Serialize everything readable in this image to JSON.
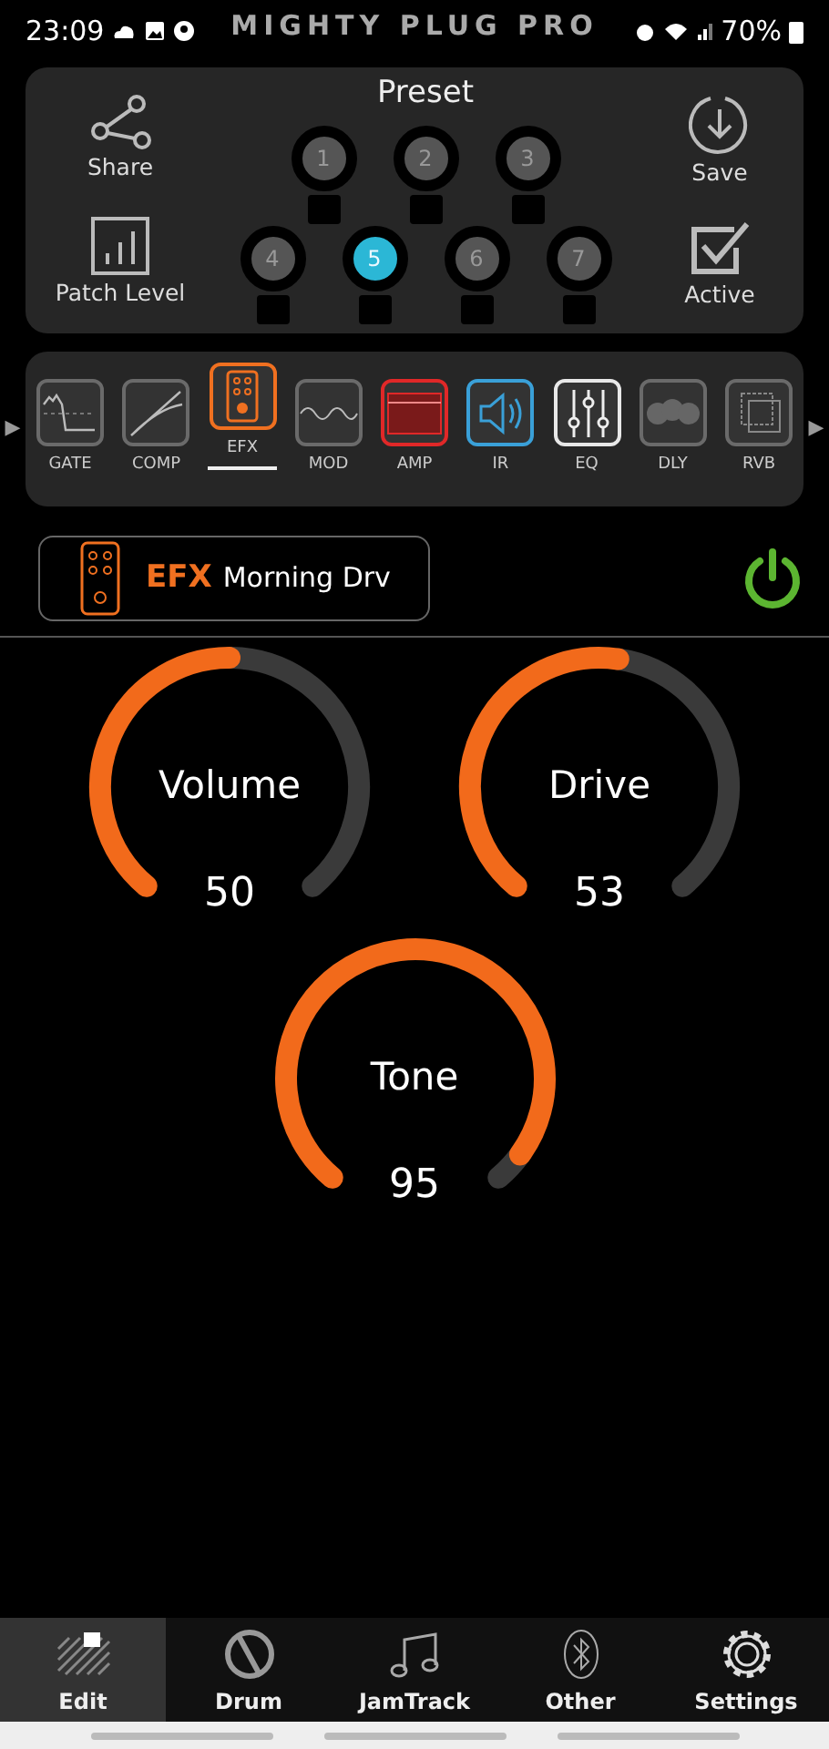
{
  "status_bar": {
    "time": "23:09",
    "battery": "70%"
  },
  "app_title": "MIGHTY PLUG PRO",
  "preset": {
    "title": "Preset",
    "share": "Share",
    "patch_level": "Patch Level",
    "save": "Save",
    "active": "Active",
    "rows": [
      [
        {
          "label": "1",
          "selected": false
        },
        {
          "label": "2",
          "selected": false
        },
        {
          "label": "3",
          "selected": false
        }
      ],
      [
        {
          "label": "4",
          "selected": false
        },
        {
          "label": "5",
          "selected": true
        },
        {
          "label": "6",
          "selected": false
        },
        {
          "label": "7",
          "selected": false
        }
      ]
    ]
  },
  "chain_scroll": {
    "left": "▶",
    "right": "▶"
  },
  "chain": [
    {
      "kind": "gate",
      "label": "GATE",
      "selected": false,
      "color": "#6a6a6a"
    },
    {
      "kind": "comp",
      "label": "COMP",
      "selected": false,
      "color": "#6a6a6a"
    },
    {
      "kind": "efx",
      "label": "EFX",
      "selected": true,
      "color": "#f07020"
    },
    {
      "kind": "mod",
      "label": "MOD",
      "selected": false,
      "color": "#6a6a6a"
    },
    {
      "kind": "amp",
      "label": "AMP",
      "selected": false,
      "color": "#e02828"
    },
    {
      "kind": "ir",
      "label": "IR",
      "selected": false,
      "color": "#3aa0d8"
    },
    {
      "kind": "eq",
      "label": "EQ",
      "selected": false,
      "color": "#e8e8e8"
    },
    {
      "kind": "dly",
      "label": "DLY",
      "selected": false,
      "color": "#6a6a6a"
    },
    {
      "kind": "rvb",
      "label": "RVB",
      "selected": false,
      "color": "#6a6a6a"
    }
  ],
  "module": {
    "type": "EFX",
    "name": "Morning Drv",
    "on": true
  },
  "knobs": [
    {
      "label": "Volume",
      "value": "50"
    },
    {
      "label": "Drive",
      "value": "53"
    },
    {
      "label": "Tone",
      "value": "95"
    }
  ],
  "nav": [
    {
      "kind": "edit",
      "label": "Edit",
      "selected": true
    },
    {
      "kind": "drum",
      "label": "Drum",
      "selected": false
    },
    {
      "kind": "jam",
      "label": "JamTrack",
      "selected": false
    },
    {
      "kind": "other",
      "label": "Other",
      "selected": false
    },
    {
      "kind": "settings",
      "label": "Settings",
      "selected": false
    }
  ]
}
